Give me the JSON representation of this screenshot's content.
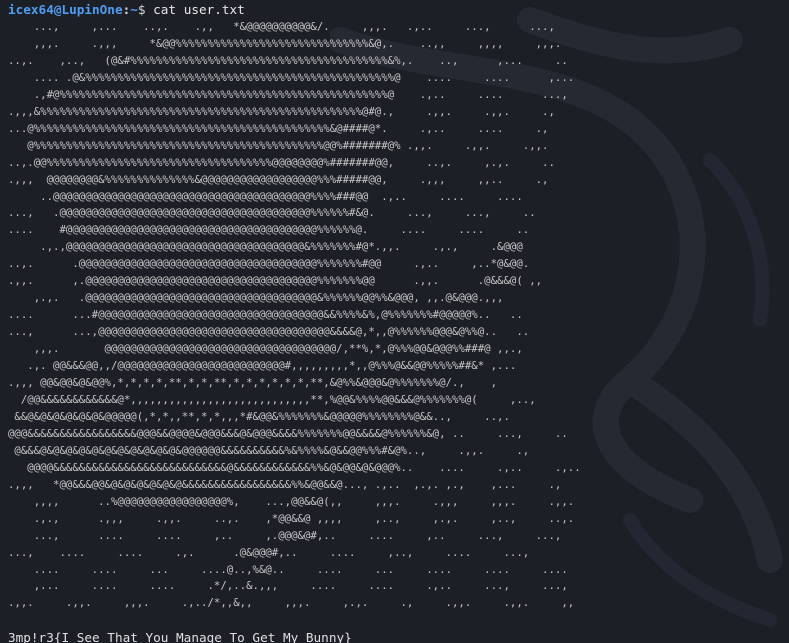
{
  "prompt": {
    "user_host": "icex64@LupinOne",
    "separator": ":",
    "path": "~",
    "symbol": "$"
  },
  "command": "cat user.txt",
  "ascii_art": "    ...,     ,...    ..,.    .,,   *&@@@@@@@@@@&/.     ,,,.   .,..     ...,      ...,\n    ,,,.     .,,,     *&@@%%%%%%%%%%%%%%%%%%%%%%%%%%%%%%&@,.    ..,,     ,,,,     ,,,.\n..,.    ,..,   (@&#%%%%%%%%%%%%%%%%%%%%%%%%%%%%%%%%%%%%%%%%&%,.    ..,      ,...     ..\n    .... .@&%%%%%%%%%%%%%%%%%%%%%%%%%%%%%%%%%%%%%%%%%%%%%%%%@    ....     ....      ,...\n    .,#@%%%%%%%%%%%%%%%%%%%%%%%%%%%%%%%%%%%%%%%%%%%%%%%%%%%@    .,..     ....      ...,\n.,,,&%%%%%%%%%%%%%%%%%%%%%%%%%%%%%%%%%%%%%%%%%%%%%%%%%%@#@.,     .,,.     .,,.     .,\n...@%%%%%%%%%%%%%%%%%%%%%%%%%%%%%%%%%%%%%%%%%%%%%%&@####@*.     .,..     ....     .,\n   @%%%%%%%%%%%%%%%%%%%%%%%%%%%%%%%%%%%%%%%%%%%%%@@%#######@% .,,.     .,,.     .,,.\n..,.@@%%%%%%%%%%%%%%%%%%%%%%%%%%%%%%%%%%%@@@@@@@@%#######@@,     ..,.     ,.,.     ..\n.,,,  @@@@@@@@&%%%%%%%%%%%%%%&@@@@@@@@@@@@@@@@@@%%%#####@@,     .,,,     ,,..     .,\n     ..@@@@@@@@@@@@@@@@@@@@@@@@@@@@@@@@@@@@@@@@%%%%###@@  .,..     ....     ....\n...,   .@@@@@@@@@@@@@@@@@@@@@@@@@@@@@@@@@@@@@@@%%%%%%#&@.     ...,     ...,     ..\n....    #@@@@@@@@@@@@@@@@@@@@@@@@@@@@@@@@@@@@@@@%%%%%%@.     ....     ....     ..\n     .,.,@@@@@@@@@@@@@@@@@@@@@@@@@@@@@@@@@@@@@&%%%%%%%#@*.,,.     .,.,     .&@@@\n..,.      .@@@@@@@@@@@@@@@@@@@@@@@@@@@@@@@@@@@@@%%%%%%%#@@     .,..     ,..*@&@@.\n.,,.      ,.@@@@@@@@@@@@@@@@@@@@@@@@@@@@@@@@@@@@%%%%%%%@@      .,,.      .@&&&@( ,,\n    ,.,.   .@@@@@@@@@@@@@@@@@@@@@@@@@@@@@@@@@@@@&%%%%%%@@%%&@@@, ,,.@&@@@.,,,\n....      ...#@@@@@@@@@@@@@@@@@@@@@@@@@@@@@@@@@@@&&%%%%&%,@%%%%%%%#@@@@@%..   ..\n...,      ...,@@@@@@@@@@@@@@@@@@@@@@@@@@@@@@@@@@@@&&&&@,*,,@%%%%%%@@@&@%%@..   ..\n    ,,,.       @@@@@@@@@@@@@@@@@@@@@@@@@@@@@@@@@@@@/,**%,*,@%%%@@&@@@%%###@ ,,.,\n   .,. @@&&&@@,,/@@@@@@@@@@@@@@@@@@@@@@@@@@#,,,,,,,,,*,,@%%%@&&@@%%%%%##&* ,...\n.,,, @@&@@&@&@@%,*,*,*,*,**,*,*,**,*,*,*,*,*,*,**,&@%%&@@@&@%%%%%%%@/.,    ,\n  /@@&&&&&&&&&&&&@*,,,,,,,,,,,,,,,,,,,,,,,,,,,,**,%@@&%%%%@@&&&@%%%%%%%@(     ,..,\n &&@&@&@&@&@&@&@@@@@(,*,*,,**,*,*,,,*#&@@&%%%%%%%&@@@@@%%%%%%%%@&&..,     ..,.\n@@@&&&&&&&&&&&&&&&&&@@@&&@@@@&@@@&&&@&@@@&&&&%%%%%%%@@&&&&@%%%%%%&@, ..     ...,     ..\n @&&&@&@&@&@&@&@&@&@&@&@&@&@@@@@@&&&&&&&&&&%&%%%%&@&&@@%%%#&@%..,     .,,.     .,\n   @@@@&&&&&&&&&&&&&&&&&&&&&&&&&&&@&&&&&&&&&&&&%%&@&@@&@&@@@%..    ....     .,..     .,..\n.,,,   *@@&&&@@&@&@&@&@&@&@&&&&&&&&&&&&&&&&&%%&@@&&@..., .,..  ,.,. ,.,    ,...     .,\n    ,,,,      ..%@@@@@@@@@@@@@@@@@%,    ...,@@&&@(,,     ,,,.     .,,,     ,,,.     .,,.\n    .,.,      .,,,     .,,.     ..,.    ,*@@&&@ ,,,,     ,..,     ,.,.     ,..,     ..,.\n    ...,      ....     ....     ,..     ,.@@@&@#,..     ....     ,..     ...,     ...,\n...,    ....     ....     .,.      .@&@@@#,..     ....     ,..,     ....     ...,\n    ....     ....     ...     ....@..,%&@..     ....     ...     ....     ....     ....\n    ,...     ....     ....     .*/,..&.,,,     ....     ....     .,..     ...,     ...,\n.,,.     .,,.     ,,,.     .,../*,,&,,     ,,,.     ,.,.     .,     .,,.     .,,.     ,,",
  "flag": "3mp!r3{I_See_That_You_Manage_To_Get_My_Bunny}",
  "colors": {
    "background": "#1d1f27",
    "prompt_blue": "#4f9df0",
    "text": "#d8d8d8"
  }
}
